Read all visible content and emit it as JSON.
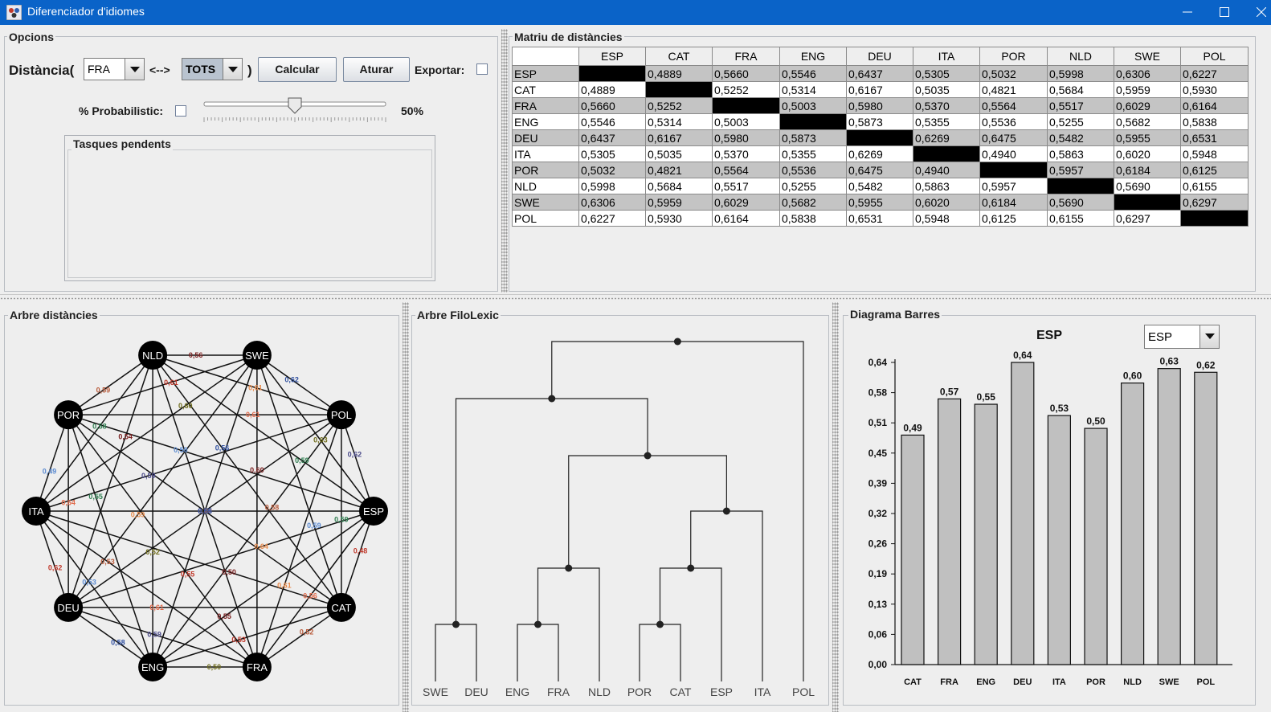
{
  "window": {
    "title": "Diferenciador d'idiomes"
  },
  "options": {
    "title": "Opcions",
    "distance_label": "Distància(",
    "lang_a": "FRA",
    "arrow_label": "<-->",
    "lang_b": "TOTS",
    "close_paren": ")",
    "calculate_button": "Calcular",
    "stop_button": "Aturar",
    "export_label": "Exportar:",
    "probabilistic_label": "% Probabilistic:",
    "slider": {
      "value": 50,
      "min": 0,
      "max": 100,
      "label": "50%"
    },
    "pending_title": "Tasques pendents"
  },
  "matrix": {
    "title": "Matriu de distàncies",
    "languages": [
      "ESP",
      "CAT",
      "FRA",
      "ENG",
      "DEU",
      "ITA",
      "POR",
      "NLD",
      "SWE",
      "POL"
    ],
    "rows": [
      [
        "",
        "0,4889",
        "0,5660",
        "0,5546",
        "0,6437",
        "0,5305",
        "0,5032",
        "0,5998",
        "0,6306",
        "0,6227"
      ],
      [
        "0,4889",
        "",
        "0,5252",
        "0,5314",
        "0,6167",
        "0,5035",
        "0,4821",
        "0,5684",
        "0,5959",
        "0,5930"
      ],
      [
        "0,5660",
        "0,5252",
        "",
        "0,5003",
        "0,5980",
        "0,5370",
        "0,5564",
        "0,5517",
        "0,6029",
        "0,6164"
      ],
      [
        "0,5546",
        "0,5314",
        "0,5003",
        "",
        "0,5873",
        "0,5355",
        "0,5536",
        "0,5255",
        "0,5682",
        "0,5838"
      ],
      [
        "0,6437",
        "0,6167",
        "0,5980",
        "0,5873",
        "",
        "0,6269",
        "0,6475",
        "0,5482",
        "0,5955",
        "0,6531"
      ],
      [
        "0,5305",
        "0,5035",
        "0,5370",
        "0,5355",
        "0,6269",
        "",
        "0,4940",
        "0,5863",
        "0,6020",
        "0,5948"
      ],
      [
        "0,5032",
        "0,4821",
        "0,5564",
        "0,5536",
        "0,6475",
        "0,4940",
        "",
        "0,5957",
        "0,6184",
        "0,6125"
      ],
      [
        "0,5998",
        "0,5684",
        "0,5517",
        "0,5255",
        "0,5482",
        "0,5863",
        "0,5957",
        "",
        "0,5690",
        "0,6155"
      ],
      [
        "0,6306",
        "0,5959",
        "0,6029",
        "0,5682",
        "0,5955",
        "0,6020",
        "0,6184",
        "0,5690",
        "",
        "0,6297"
      ],
      [
        "0,6227",
        "0,5930",
        "0,6164",
        "0,5838",
        "0,6531",
        "0,5948",
        "0,6125",
        "0,6155",
        "0,6297",
        ""
      ]
    ]
  },
  "distance_tree": {
    "title": "Arbre distàncies",
    "nodes": [
      "ESP",
      "CAT",
      "FRA",
      "ENG",
      "DEU",
      "ITA",
      "POR",
      "NLD",
      "SWE",
      "POL"
    ]
  },
  "filo_tree": {
    "title": "Arbre FiloLexic",
    "leaves": [
      "SWE",
      "DEU",
      "ENG",
      "FRA",
      "NLD",
      "POR",
      "CAT",
      "ESP",
      "ITA",
      "POL"
    ]
  },
  "bar_panel": {
    "title": "Diagrama Barres",
    "selector_value": "ESP"
  },
  "chart_data": {
    "type": "bar",
    "title": "ESP",
    "categories": [
      "CAT",
      "FRA",
      "ENG",
      "DEU",
      "ITA",
      "POR",
      "NLD",
      "SWE",
      "POL"
    ],
    "values": [
      0.4889,
      0.566,
      0.5546,
      0.6437,
      0.5305,
      0.5032,
      0.5998,
      0.6306,
      0.6227
    ],
    "value_labels": [
      "0,49",
      "0,57",
      "0,55",
      "0,64",
      "0,53",
      "0,50",
      "0,60",
      "0,63",
      "0,62"
    ],
    "ylim": [
      0,
      0.6437
    ],
    "yticks": [
      "0,00",
      "0,06",
      "0,13",
      "0,19",
      "0,26",
      "0,32",
      "0,39",
      "0,45",
      "0,51",
      "0,58",
      "0,64"
    ],
    "bar_color": "#c0c0c0"
  }
}
